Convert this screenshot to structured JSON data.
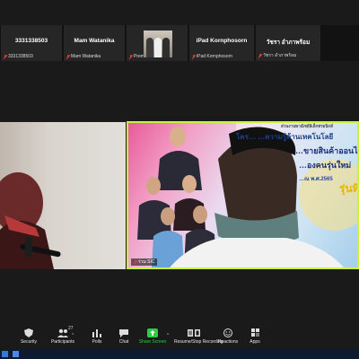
{
  "participants": [
    {
      "name": "3331338503",
      "sub": "3331338503"
    },
    {
      "name": "Mam Watanika",
      "sub": "Mam Watanika"
    },
    {
      "name": "",
      "sub": "Prems Wiracholk"
    },
    {
      "name": "iPad Kornphosorn",
      "sub": "iPad Kornphosorn"
    },
    {
      "name": "วัชรา อำภาพร้อม",
      "sub": "วัชรา อำภาพร้อม"
    }
  ],
  "video_right": {
    "label": "ร่วม SIC",
    "poster_top": "ส่วนงานพาณิชย์อิเล็กทรอนิกส์",
    "poster_line1": "โคร…     …ความรู้ด้านเทคโนโลยี",
    "poster_line2": "…ขายสินค้าออนไ…",
    "poster_line3": "…องคนรุ่นใหม่",
    "poster_line4": "…ณ พ.ศ.2565",
    "poster_line5": "รุ่นที่"
  },
  "toolbar": {
    "security": "Security",
    "participants": "Participants",
    "participants_count": "27",
    "polls": "Polls",
    "chat": "Chat",
    "share_screen": "Share Screen",
    "recording": "Resume/Stop Recording",
    "reactions": "Reactions",
    "apps": "Apps"
  },
  "colors": {
    "active_speaker_border": "#c9f23a",
    "share_green": "#2ecc40",
    "muted_red": "#e23b3b"
  }
}
